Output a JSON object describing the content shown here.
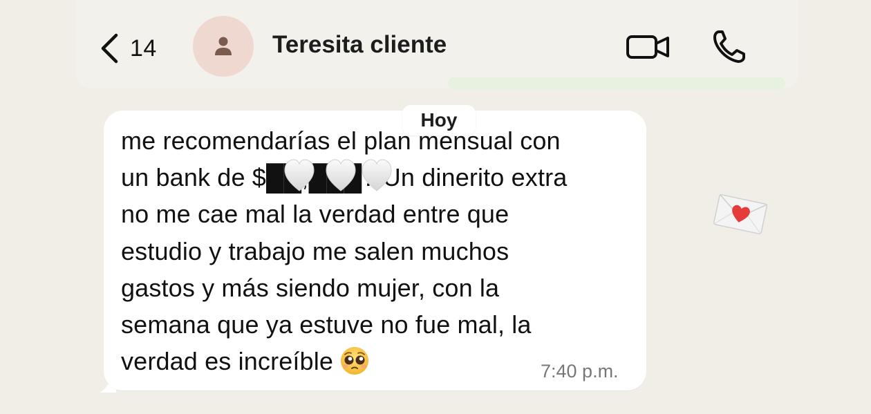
{
  "header": {
    "back_count": "14",
    "contact_name": "Teresita cliente"
  },
  "chat": {
    "date_label": "Hoy",
    "message": {
      "text": "me recomendarías el plan mensual con\nun bank de $██,███? Un dinerito extra\nno me cae mal la verdad entre que\nestudio y trabajo me salen muchos\ngastos y más siendo mujer, con la\nsemana que ya estuve no fue mal, la\nverdad es increíble",
      "emoji": "pleading-face-emoji",
      "timestamp": "7:40 p.m."
    }
  },
  "colors": {
    "background": "#f1eee7",
    "bubble": "#ffffff",
    "avatar_bg": "#efd8cf",
    "avatar_icon": "#7b5a50",
    "timestamp": "#777777",
    "icon": "#111111",
    "heart": "#e53b3b"
  },
  "icons": {
    "back": "chevron-left-icon",
    "avatar": "person-icon",
    "video": "video-camera-icon",
    "phone": "phone-icon",
    "sticker": "envelope-heart-sticker"
  }
}
